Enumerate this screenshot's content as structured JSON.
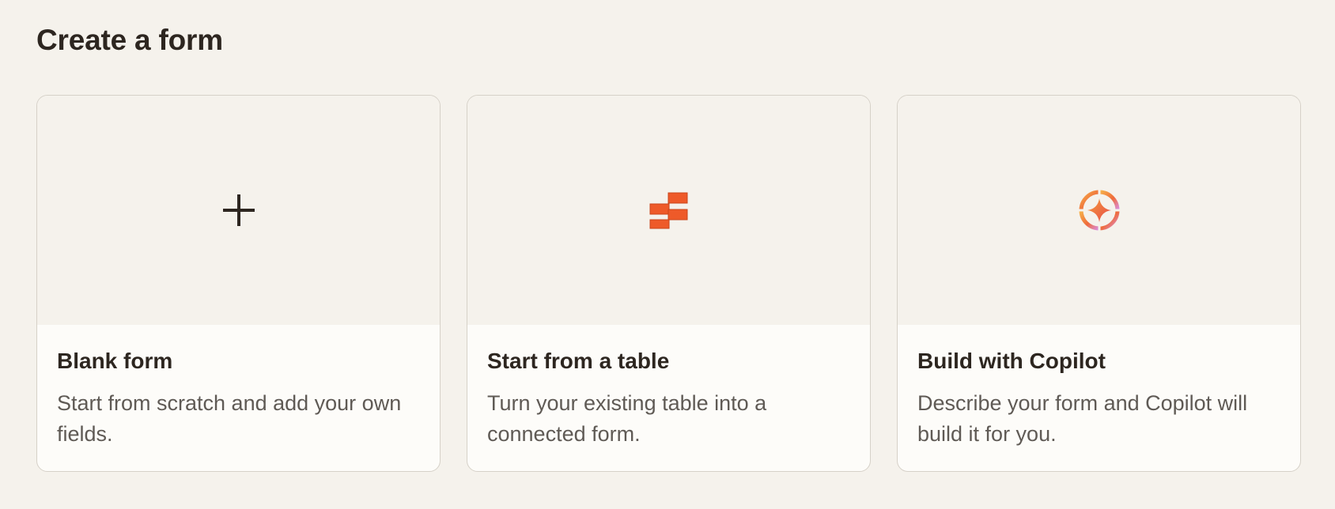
{
  "page": {
    "title": "Create a form"
  },
  "cards": [
    {
      "title": "Blank form",
      "description": "Start from scratch and add your own fields.",
      "icon": "plus-icon"
    },
    {
      "title": "Start from a table",
      "description": "Turn your existing table into a connected form.",
      "icon": "table-icon"
    },
    {
      "title": "Build with Copilot",
      "description": "Describe your form and Copilot will build it for you.",
      "icon": "copilot-icon"
    }
  ],
  "colors": {
    "background": "#f5f2ec",
    "card_body": "#fdfcf9",
    "border": "#d6d1c8",
    "heading": "#2d2620",
    "muted_text": "#5f5a55",
    "table_icon": "#ee5a29"
  }
}
